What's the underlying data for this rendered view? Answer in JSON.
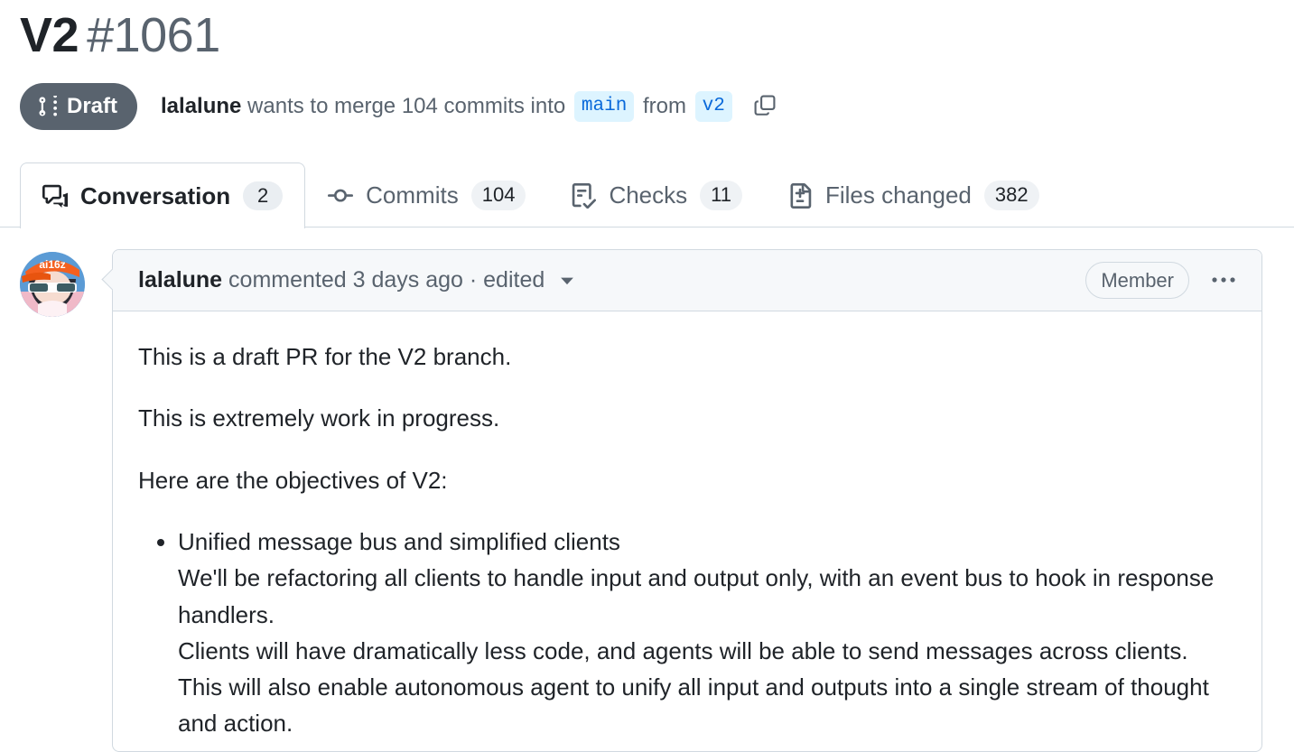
{
  "pull_request": {
    "title": "V2",
    "number": "#1061",
    "state": {
      "label": "Draft",
      "icon": "git-pull-request-draft-icon",
      "color": "#59636e"
    },
    "merge_info": {
      "author": "lalalune",
      "text_before_count": " wants to merge ",
      "commit_count": "104",
      "text_after_count": " commits into ",
      "base_branch": "main",
      "from_label": " from ",
      "head_branch": "v2",
      "copy_icon": "copy-icon"
    }
  },
  "tabs": [
    {
      "label": "Conversation",
      "count": "2",
      "icon": "comment-discussion-icon",
      "selected": true
    },
    {
      "label": "Commits",
      "count": "104",
      "icon": "git-commit-icon",
      "selected": false
    },
    {
      "label": "Checks",
      "count": "11",
      "icon": "checklist-icon",
      "selected": false
    },
    {
      "label": "Files changed",
      "count": "382",
      "icon": "file-diff-icon",
      "selected": false
    }
  ],
  "comment": {
    "avatar_alt": "lalalune-avatar",
    "author": "lalalune",
    "action": " commented ",
    "timestamp": "3 days ago",
    "separator": " · ",
    "edited_label": "edited",
    "caret_icon": "chevron-down-icon",
    "author_association": "Member",
    "menu_icon": "kebab-horizontal-icon",
    "body": {
      "paragraph_1": "This is a draft PR for the V2 branch.",
      "paragraph_2": "This is extremely work in progress.",
      "paragraph_3": "Here are the objectives of V2:",
      "bullets": [
        {
          "lines": [
            "Unified message bus and simplified clients",
            "We'll be refactoring all clients to handle input and output only, with an event bus to hook in response handlers.",
            "Clients will have dramatically less code, and agents will be able to send messages across clients.",
            "This will also enable autonomous agent to unify all input and outputs into a single stream of thought and action."
          ]
        }
      ]
    }
  },
  "colors": {
    "accent_blue": "#0969da",
    "branch_chip_bg": "#ddf4ff",
    "border": "#d1d9e0",
    "muted_text": "#59636e",
    "header_bg": "#f6f8fa",
    "draft_gray": "#59636e"
  }
}
